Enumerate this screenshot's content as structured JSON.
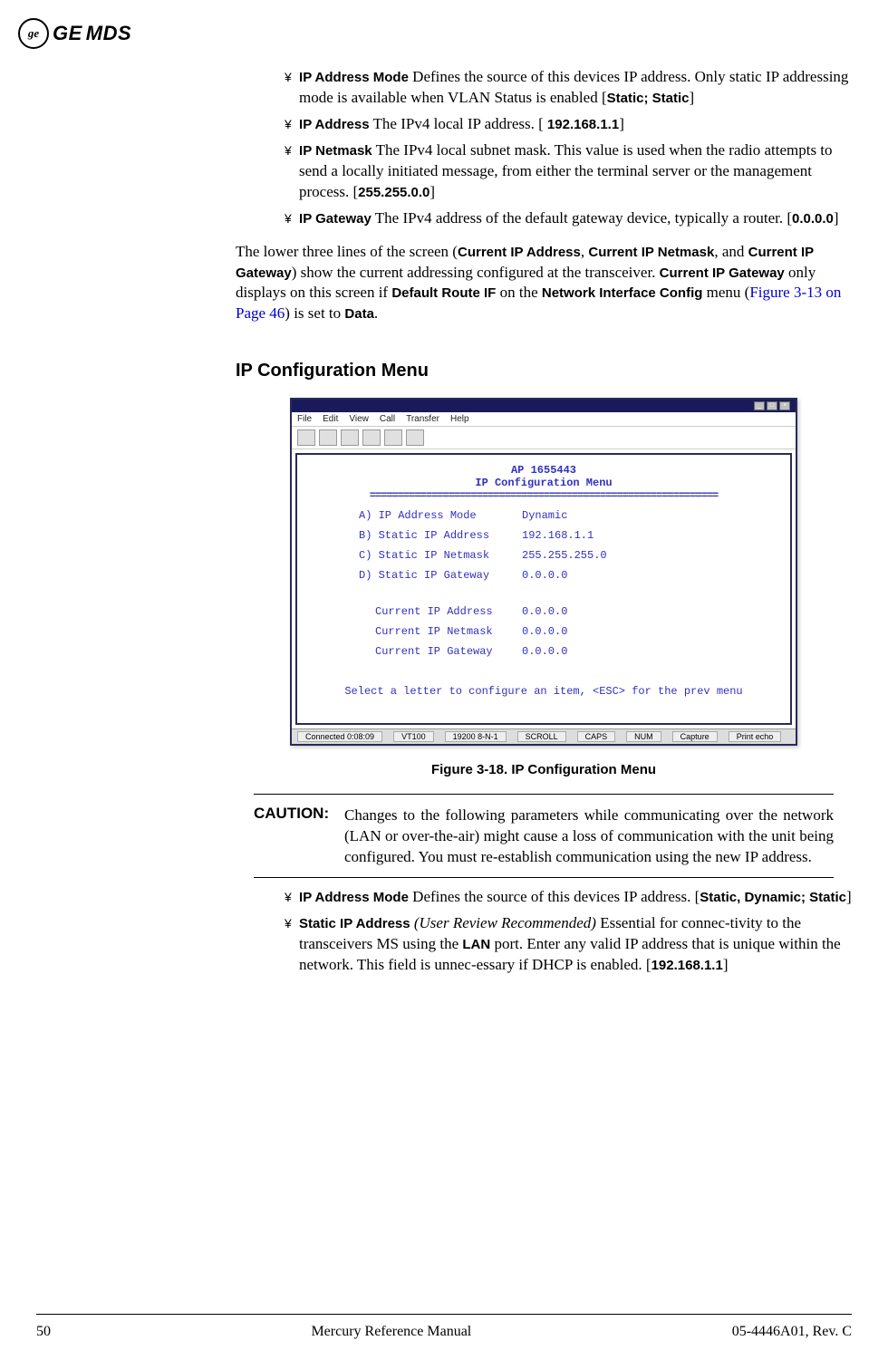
{
  "header": {
    "brand_ge": "GE",
    "brand_mds": "MDS",
    "logo_text": "ge"
  },
  "bullets_top": {
    "ip_address_mode": {
      "label": "IP Address Mode",
      "text1": "Defines the source of this device",
      "text2": "s IP address. Only static IP addressing mode is available when VLAN Status is enabled [",
      "val": "Static; Static",
      "close": "]"
    },
    "ip_address": {
      "label": "IP Address",
      "text": "The IPv4 local IP address. [",
      "val": " 192.168.1.1",
      "close": "]"
    },
    "ip_netmask": {
      "label": "IP Netmask",
      "text": "The IPv4 local subnet mask. This value is used when the radio attempts to send a locally initiated message, from either the terminal server or the management process. [",
      "val": "255.255.0.0",
      "close": "]"
    },
    "ip_gateway": {
      "label": "IP Gateway",
      "text": "The IPv4 address of the default gateway device, typically a router. [",
      "val": "0.0.0.0",
      "close": "]"
    }
  },
  "mid_paragraph": {
    "p1": "The lower three lines of the screen (",
    "b1": "Current IP Address",
    "p2": ", ",
    "b2": "Current IP Netmask",
    "p3": ", and ",
    "b3": "Current IP Gateway",
    "p4": ") show the current addressing configured at the transceiver. ",
    "b4": "Current IP Gateway",
    "p5": " only displays on this screen if ",
    "b5": "Default Route IF",
    "p6": " on the ",
    "b6": "Network Interface Config",
    "p7": " menu (",
    "link": "Figure 3-13 on Page 46",
    "p8": ") is set to ",
    "b7": "Data",
    "p9": "."
  },
  "section_heading": "IP Configuration Menu",
  "terminal": {
    "title_left": "",
    "menu": {
      "file": "File",
      "edit": "Edit",
      "view": "View",
      "call": "Call",
      "transfer": "Transfer",
      "help": "Help"
    },
    "head1": "AP 1655443",
    "head2": "IP Configuration Menu",
    "rows": [
      {
        "k": "A) IP Address Mode",
        "v": "Dynamic"
      },
      {
        "k": "B) Static IP Address",
        "v": "192.168.1.1"
      },
      {
        "k": "C) Static IP Netmask",
        "v": "255.255.255.0"
      },
      {
        "k": "D) Static IP Gateway",
        "v": "0.0.0.0"
      }
    ],
    "rows2": [
      {
        "k": "Current IP Address",
        "v": "0.0.0.0"
      },
      {
        "k": "Current IP Netmask",
        "v": "0.0.0.0"
      },
      {
        "k": "Current IP Gateway",
        "v": "0.0.0.0"
      }
    ],
    "footer_msg": "Select a letter to configure an item, <ESC> for the prev menu",
    "status": {
      "s1": "Connected 0:08:09",
      "s2": "VT100",
      "s3": "19200 8-N-1",
      "s4": "SCROLL",
      "s5": "CAPS",
      "s6": "NUM",
      "s7": "Capture",
      "s8": "Print echo"
    }
  },
  "figure_caption": "Figure 3-18. IP Configuration Menu",
  "caution": {
    "label": "CAUTION:",
    "text": "Changes to the following parameters while communicating over the network (LAN or over-the-air) might cause a loss of communication with the unit being configured. You must re-establish communication using the new IP address."
  },
  "bullets_bottom": {
    "ip_address_mode": {
      "label": "IP Address Mode",
      "text1": "Defines the source of this device",
      "text2": "s IP address. [",
      "val": "Static, Dynamic; Static",
      "close": "]"
    },
    "static_ip_address": {
      "label": "Static IP Address",
      "note": " (User Review Recommended)",
      "text1": "Essential for connec-tivity to the transceiver",
      "text2": "s MS using the",
      "lan": "LAN",
      "text3": " port. Enter any valid IP address that is unique within the network. This field is unnec-essary if DHCP is enabled. [",
      "val": "192.168.1.1",
      "close": "]"
    }
  },
  "bullet_marker": "¥",
  "footer": {
    "page": "50",
    "center": "Mercury Reference Manual",
    "right": "05-4446A01, Rev. C"
  }
}
